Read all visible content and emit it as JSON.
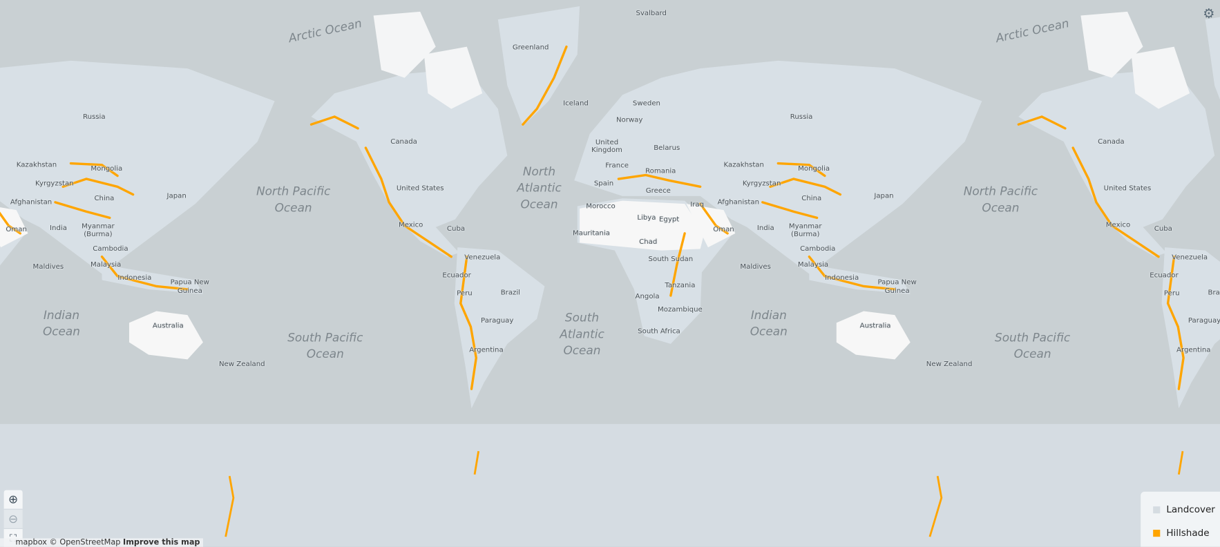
{
  "map": {
    "colors": {
      "ocean": "#c9d0d3",
      "land": "#d8e0e6",
      "highlight": "#f7f7f7",
      "hillshade": "#ffa500",
      "antarctica": "#d5dce2"
    },
    "oceans": {
      "arctic": "Arctic Ocean",
      "north_pacific": [
        "North Pacific",
        "Ocean"
      ],
      "north_atlantic": [
        "North",
        "Atlantic",
        "Ocean"
      ],
      "indian": [
        "Indian",
        "Ocean"
      ],
      "south_pacific": [
        "South Pacific",
        "Ocean"
      ],
      "south_atlantic": [
        "South",
        "Atlantic",
        "Ocean"
      ]
    },
    "labels": {
      "greenland": "Greenland",
      "svalbard": "Svalbard",
      "iceland": "Iceland",
      "sweden": "Sweden",
      "norway": "Norway",
      "russia": "Russia",
      "canada": "Canada",
      "uk1": "United",
      "uk2": "Kingdom",
      "belarus": "Belarus",
      "kazakhstan": "Kazakhstan",
      "mongolia": "Mongolia",
      "france": "France",
      "romania": "Romania",
      "kyrgyzstan": "Kyrgyzstan",
      "spain": "Spain",
      "greece": "Greece",
      "us": "United States",
      "china": "China",
      "japan": "Japan",
      "iraq": "Iraq",
      "afghanistan": "Afghanistan",
      "morocco": "Morocco",
      "libya": "Libya",
      "egypt": "Egypt",
      "india": "India",
      "oman": "Oman",
      "mexico": "Mexico",
      "cuba": "Cuba",
      "mauritania": "Mauritania",
      "myanmar1": "Myanmar",
      "myanmar2": "(Burma)",
      "chad": "Chad",
      "cambodia": "Cambodia",
      "south_sudan": "South Sudan",
      "venezuela": "Venezuela",
      "maldives": "Maldives",
      "malaysia": "Malaysia",
      "ecuador": "Ecuador",
      "indonesia": "Indonesia",
      "png1": "Papua New",
      "png2": "Guinea",
      "tanzania": "Tanzania",
      "peru": "Peru",
      "brazil": "Brazil",
      "angola": "Angola",
      "mozambique": "Mozambique",
      "paraguay": "Paraguay",
      "australia": "Australia",
      "south_africa": "South Africa",
      "argentina": "Argentina",
      "new_zealand": "New Zealand"
    }
  },
  "controls": {
    "zoom_in": "zoom-in",
    "zoom_out": "zoom-out",
    "fit": "fit-bounds",
    "settings": "gear"
  },
  "attribution": {
    "text": "mapbox © OpenStreetMap",
    "link": "Improve this map"
  },
  "legend": {
    "items": [
      {
        "label": "Landcover",
        "color": "#d5dce1"
      },
      {
        "label": "Hillshade",
        "color": "#ffa500"
      }
    ]
  }
}
